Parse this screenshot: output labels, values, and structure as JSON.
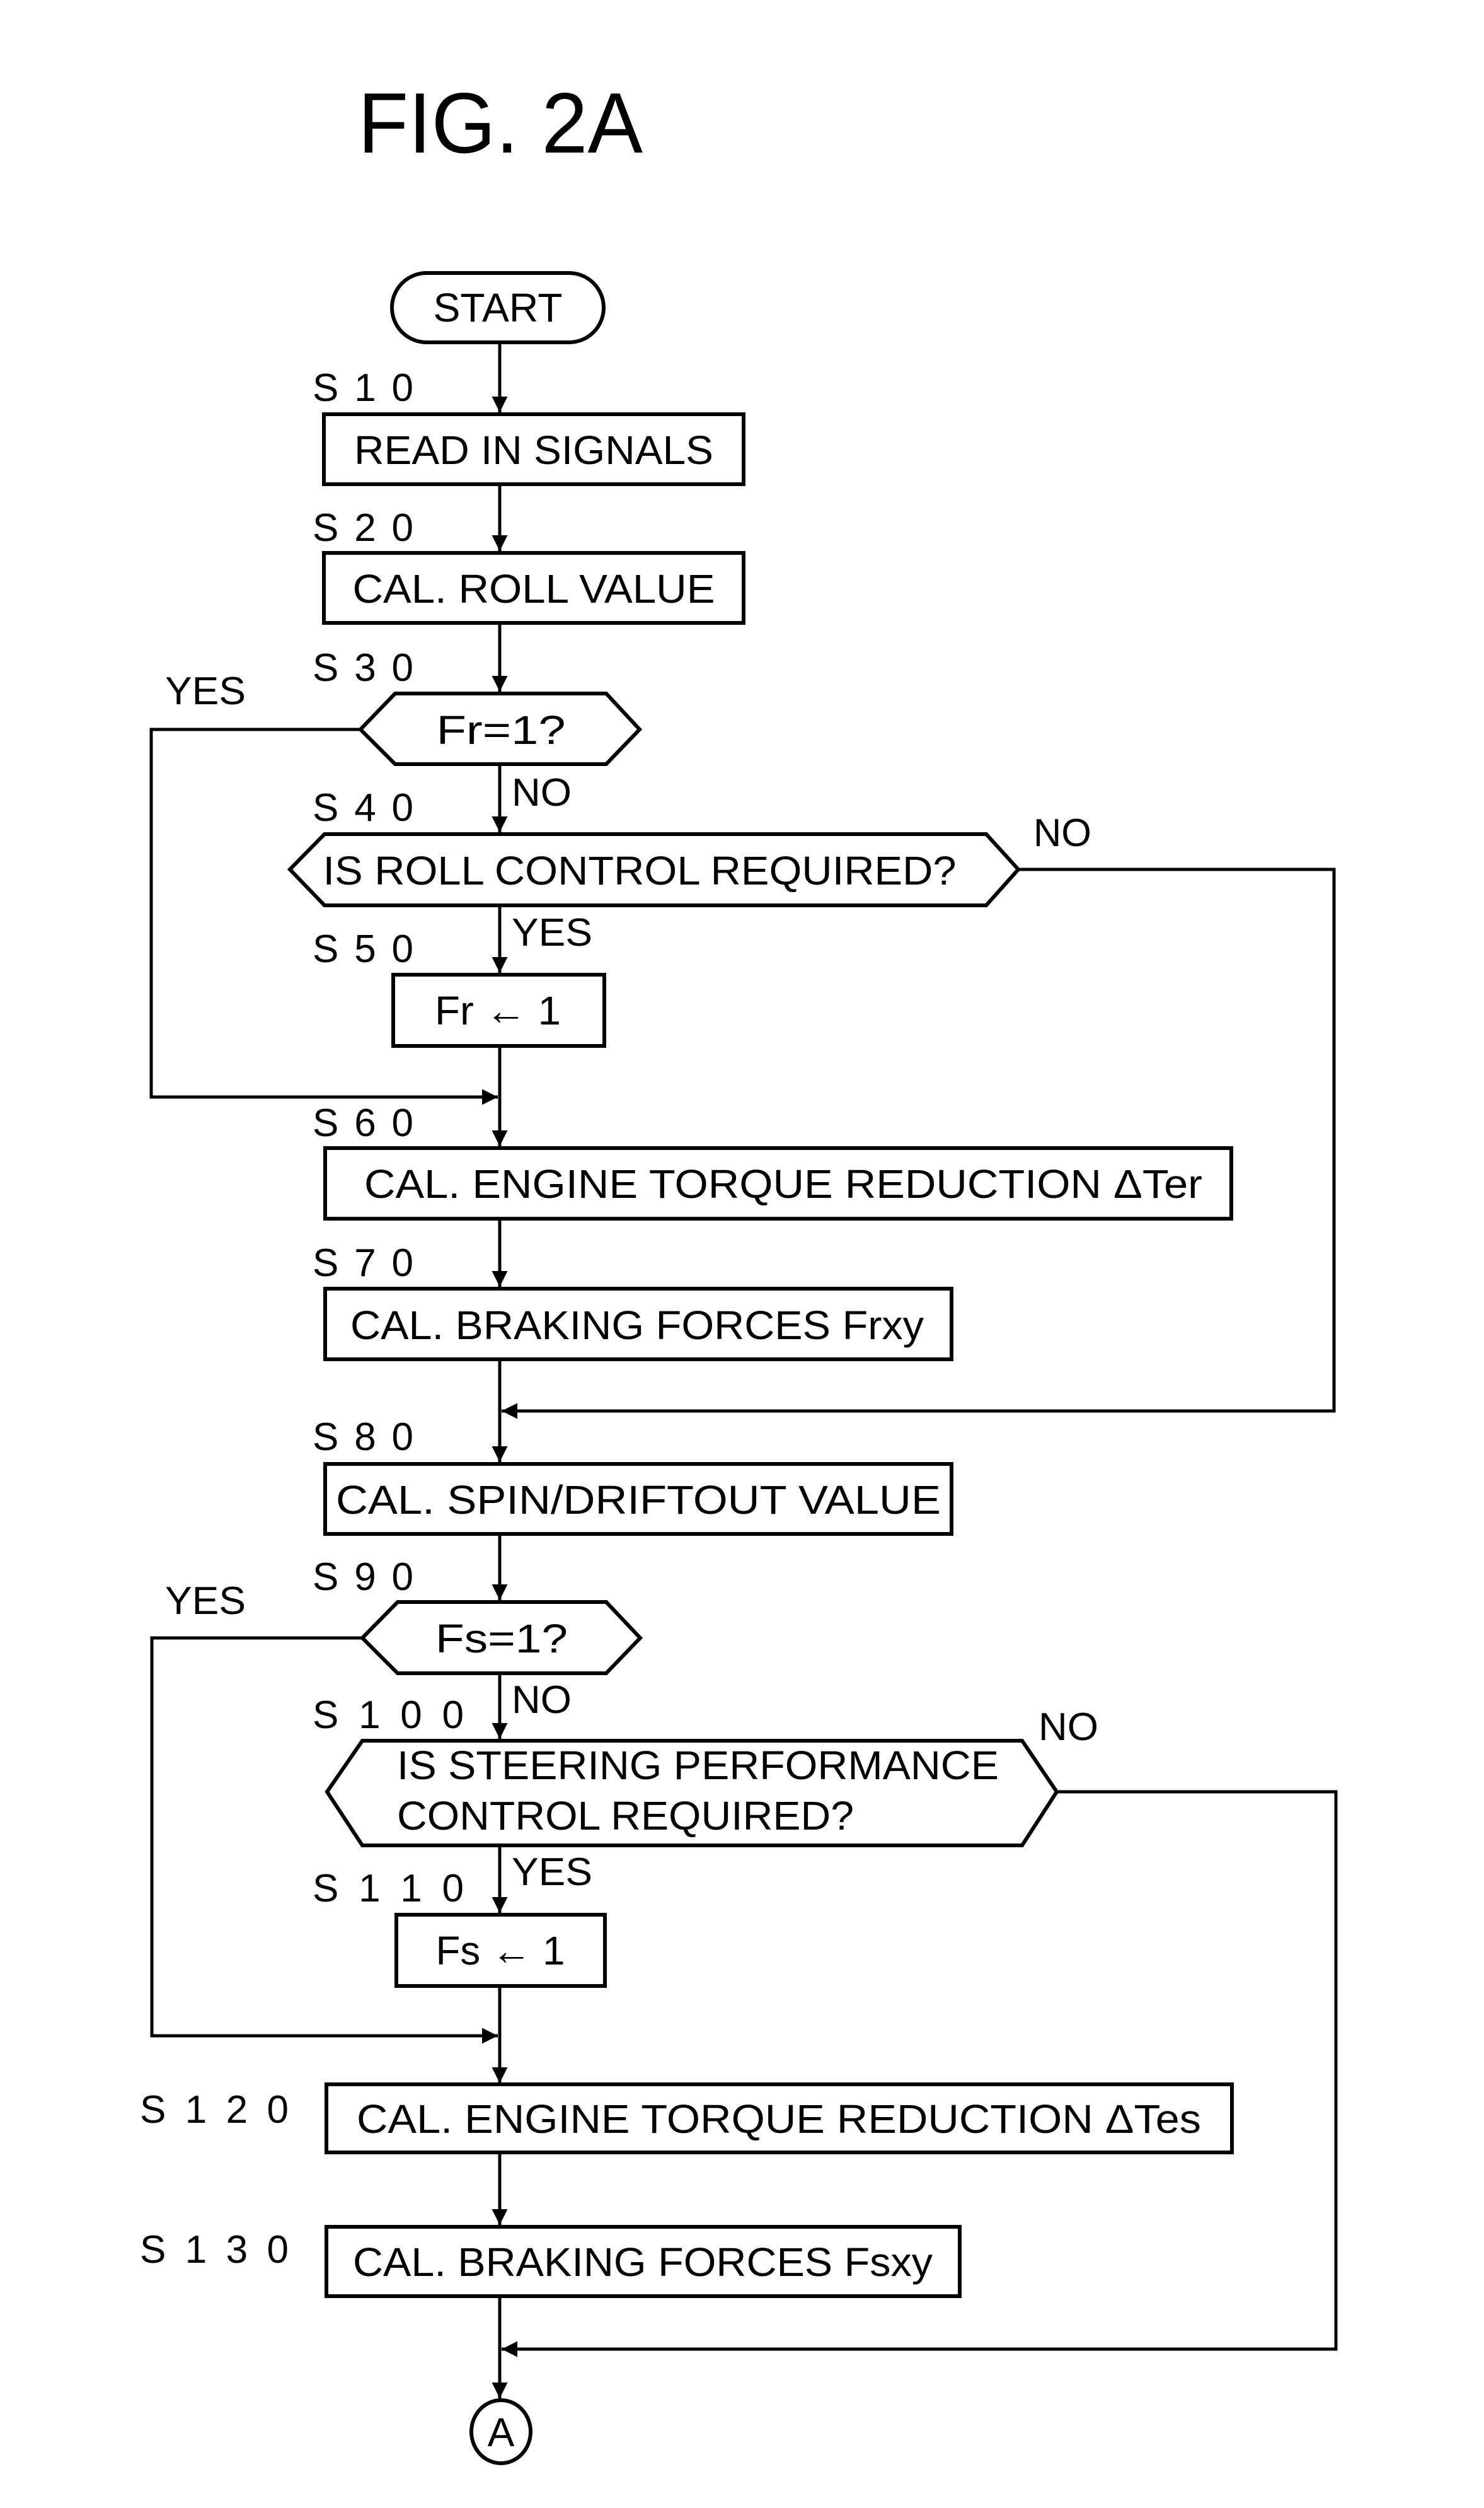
{
  "title": "FIG. 2A",
  "colors": {
    "ink": "#000000",
    "paper": "#ffffff"
  },
  "terminator_start": "START",
  "connector_end": "A",
  "steps": {
    "s10": {
      "id": "S 1 0",
      "text": "READ IN SIGNALS"
    },
    "s20": {
      "id": "S 2 0",
      "text": "CAL. ROLL VALUE"
    },
    "s30": {
      "id": "S 3 0",
      "text": "Fr=1?",
      "yes": "YES",
      "no": "NO"
    },
    "s40": {
      "id": "S 4 0",
      "text": "IS ROLL CONTROL REQUIRED?",
      "yes": "YES",
      "no": "NO"
    },
    "s50": {
      "id": "S 5 0",
      "text": "Fr ← 1"
    },
    "s60": {
      "id": "S 6 0",
      "text": "CAL. ENGINE TORQUE REDUCTION ΔTer"
    },
    "s70": {
      "id": "S 7 0",
      "text": "CAL. BRAKING FORCES Frxy"
    },
    "s80": {
      "id": "S 8 0",
      "text": "CAL. SPIN/DRIFTOUT VALUE"
    },
    "s90": {
      "id": "S 9 0",
      "text": "Fs=1?",
      "yes": "YES",
      "no": "NO"
    },
    "s100": {
      "id": "S 1 0 0",
      "text_line1": "IS STEERING PERFORMANCE",
      "text_line2": "CONTROL REQUIRED?",
      "yes": "YES",
      "no": "NO"
    },
    "s110": {
      "id": "S 1 1 0",
      "text": "Fs ← 1"
    },
    "s120": {
      "id": "S 1 2 0",
      "text": "CAL. ENGINE TORQUE REDUCTION ΔTes"
    },
    "s130": {
      "id": "S 1 3 0",
      "text": "CAL. BRAKING FORCES Fsxy"
    }
  }
}
